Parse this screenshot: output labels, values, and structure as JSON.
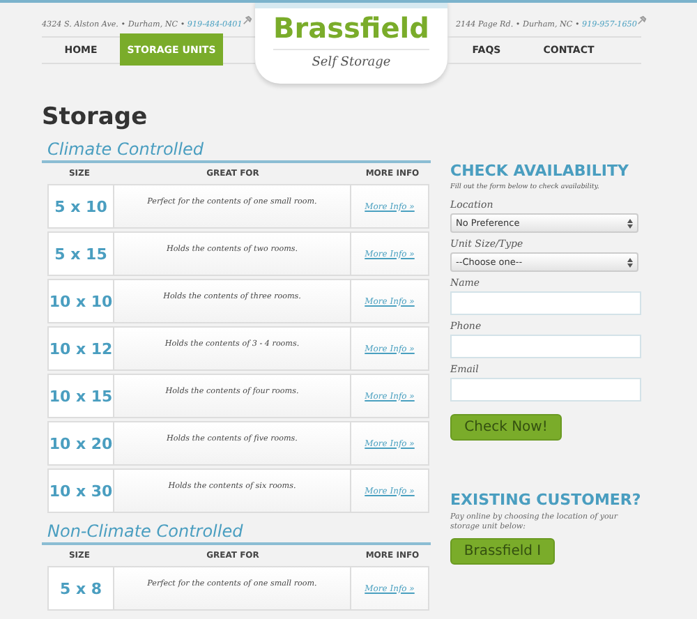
{
  "header": {
    "left_address": "4324 S. Alston Ave. • Durham, NC • ",
    "left_phone": "919-484-0401",
    "right_address": "2144 Page Rd. • Durham, NC • ",
    "right_phone": "919-957-1650",
    "nav_left": [
      {
        "label": "HOME",
        "selected": false
      },
      {
        "label": "STORAGE UNITS",
        "selected": true
      }
    ],
    "nav_right": [
      {
        "label": "FAQS",
        "selected": false
      },
      {
        "label": "CONTACT",
        "selected": false
      }
    ],
    "logo": {
      "name": "Brassfield",
      "tagline": "Self Storage"
    }
  },
  "page_title": "Storage",
  "sections": [
    {
      "title": "Climate Controlled",
      "columns": [
        "SIZE",
        "GREAT FOR",
        "MORE INFO"
      ],
      "rows": [
        {
          "size": "5 x 10",
          "great_for": "Perfect for the contents of one small room.",
          "link": "More Info »"
        },
        {
          "size": "5 x 15",
          "great_for": "Holds the contents of two rooms.",
          "link": "More Info »"
        },
        {
          "size": "10 x 10",
          "great_for": "Holds the contents of three rooms.",
          "link": "More Info »"
        },
        {
          "size": "10 x 12",
          "great_for": "Holds the contents of 3 - 4 rooms.",
          "link": "More Info »"
        },
        {
          "size": "10 x 15",
          "great_for": "Holds the contents of four rooms.",
          "link": "More Info »"
        },
        {
          "size": "10 x 20",
          "great_for": "Holds the contents of five rooms.",
          "link": "More Info »"
        },
        {
          "size": "10 x 30",
          "great_for": "Holds the contents of six rooms.",
          "link": "More Info »"
        }
      ]
    },
    {
      "title": "Non-Climate Controlled",
      "columns": [
        "SIZE",
        "GREAT FOR",
        "MORE INFO"
      ],
      "rows": [
        {
          "size": "5 x 8",
          "great_for": "Perfect for the contents of one small room.",
          "link": "More Info »"
        }
      ]
    }
  ],
  "check_availability": {
    "title": "CHECK AVAILABILITY",
    "intro": "Fill out the form below to check availability.",
    "fields": [
      {
        "label": "Location",
        "kind": "select",
        "value": "No Preference"
      },
      {
        "label": "Unit Size/Type",
        "kind": "select",
        "value": "--Choose one--"
      },
      {
        "label": "Name",
        "kind": "text"
      },
      {
        "label": "Phone",
        "kind": "text"
      },
      {
        "label": "Email",
        "kind": "text"
      }
    ],
    "button": "Check Now!"
  },
  "existing_customer": {
    "title": "EXISTING CUSTOMER?",
    "text": "Pay online by choosing the location of your storage unit below:",
    "button": "Brassfield I"
  }
}
